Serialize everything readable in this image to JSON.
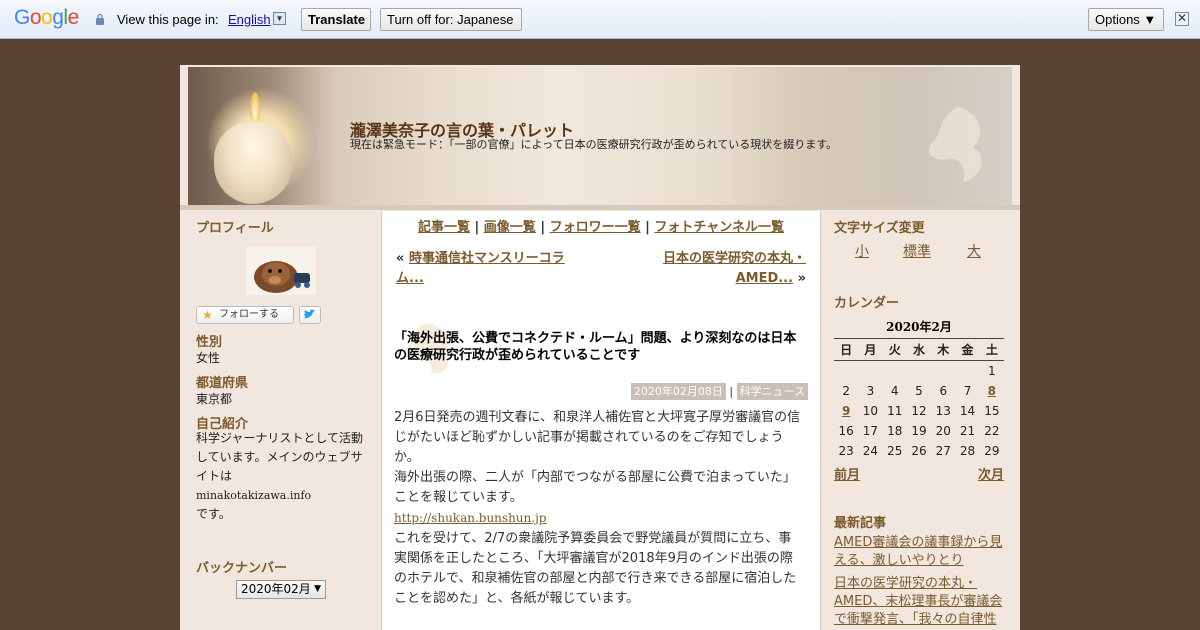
{
  "translate_bar": {
    "logo": "Google",
    "view_text": "View this page in:",
    "language": "English",
    "translate_button": "Translate",
    "turn_off_button": "Turn off for: Japanese",
    "options_button": "Options ▼",
    "close_symbol": "✕"
  },
  "header": {
    "title": "瀧澤美奈子の言の葉・パレット",
    "description": "現在は緊急モード：「一部の官僚」によって日本の医療研究行政が歪められている現状を綴ります。"
  },
  "left_sidebar": {
    "profile_heading": "プロフィール",
    "follow_label": "フォローする",
    "gender_label": "性別",
    "gender_value": "女性",
    "prefecture_label": "都道府県",
    "prefecture_value": "東京都",
    "intro_label": "自己紹介",
    "intro_text": "科学ジャーナリストとして活動しています。メインのウェブサイトは",
    "intro_site": "minakotakizawa.info",
    "intro_tail": "です。",
    "backnumber_heading": "バックナンバー",
    "backnumber_selected": "2020年02月"
  },
  "nav": {
    "articles": "記事一覧",
    "images": "画像一覧",
    "followers": "フォロワー一覧",
    "photo_channel": "フォトチャンネル一覧",
    "sep": "|"
  },
  "article": {
    "prev_prefix": "«",
    "prev_link": "時事通信社マンスリーコラム...",
    "next_link": "日本の医学研究の本丸・AMED...",
    "next_suffix": "»",
    "title": "「海外出張、公費でコネクテド・ルーム」問題、より深刻なのは日本の医療研究行政が歪められていることです",
    "date": "2020年02月08日",
    "category": "科学ニュース",
    "p1": "2月6日発売の週刊文春に、和泉洋人補佐官と大坪寛子厚労審議官の信じがたいほど恥ずかしい記事が掲載されているのをご存知でしょうか。",
    "p2": "海外出張の際、二人が「内部でつながる部屋に公費で泊まっていた」ことを報じています。",
    "link": "http://shukan.bunshun.jp",
    "p3": "これを受けて、2/7の衆議院予算委員会で野党議員が質問に立ち、事実関係を正したところ、「大坪審議官が2018年9月のインド出張の際のホテルで、和泉補佐官の部屋と内部で行き来できる部屋に宿泊したことを認めた」と、各紙が報じています。"
  },
  "right_sidebar": {
    "font_heading": "文字サイズ変更",
    "font_small": "小",
    "font_normal": "標準",
    "font_large": "大",
    "calendar_heading": "カレンダー",
    "calendar_caption": "2020年2月",
    "weekdays": [
      "日",
      "月",
      "火",
      "水",
      "木",
      "金",
      "土"
    ],
    "weeks": [
      [
        "",
        "",
        "",
        "",
        "",
        "",
        "1"
      ],
      [
        "2",
        "3",
        "4",
        "5",
        "6",
        "7",
        "8"
      ],
      [
        "9",
        "10",
        "11",
        "12",
        "13",
        "14",
        "15"
      ],
      [
        "16",
        "17",
        "18",
        "19",
        "20",
        "21",
        "22"
      ],
      [
        "23",
        "24",
        "25",
        "26",
        "27",
        "28",
        "29"
      ]
    ],
    "linked_days": [
      "8",
      "9"
    ],
    "prev_month": "前月",
    "next_month": "次月",
    "recent_heading": "最新記事",
    "recent_1": "AMED審議会の議事録から見える、激しいやりとり",
    "recent_2": "日本の医学研究の本丸・AMED、末松理事長が審議会で衝撃発言、「我々の自律性"
  },
  "colors": {
    "background": "#5a4333",
    "accent": "#7b5b2e",
    "link_blue": "#1a0dab"
  }
}
